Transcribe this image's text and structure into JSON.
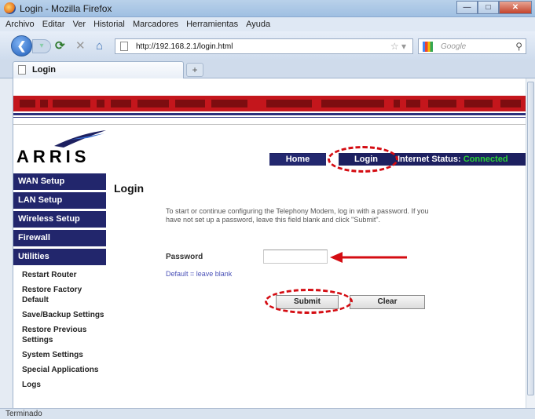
{
  "window": {
    "title": "Login - Mozilla Firefox"
  },
  "menu": [
    "Archivo",
    "Editar",
    "Ver",
    "Historial",
    "Marcadores",
    "Herramientas",
    "Ayuda"
  ],
  "address": {
    "url": "http://192.168.2.1/login.html"
  },
  "search": {
    "placeholder": "Google"
  },
  "tab": {
    "title": "Login"
  },
  "brand": {
    "logo_text": "ARRIS"
  },
  "topnav": {
    "home": "Home",
    "login": "Login",
    "status_label": "Internet Status:",
    "status_value": "Connected"
  },
  "sidebar": {
    "main": [
      "WAN Setup",
      "LAN Setup",
      "Wireless Setup",
      "Firewall",
      "Utilities"
    ],
    "sub": [
      "Restart Router",
      "Restore Factory Default",
      "Save/Backup Settings",
      "Restore Previous Settings",
      "System Settings",
      "Special Applications",
      "Logs"
    ]
  },
  "main": {
    "heading": "Login",
    "intro": "To start or continue configuring the Telephony Modem, log in with a password. If you have not set up a password, leave this field blank and click \"Submit\".",
    "password_label": "Password",
    "password_value": "",
    "default_note": "Default = leave blank",
    "submit_label": "Submit",
    "clear_label": "Clear"
  },
  "status_bar": {
    "text": "Terminado"
  },
  "colors": {
    "accent_red": "#d40c12",
    "nav_blue": "#1d2060",
    "status_green": "#29d135"
  }
}
